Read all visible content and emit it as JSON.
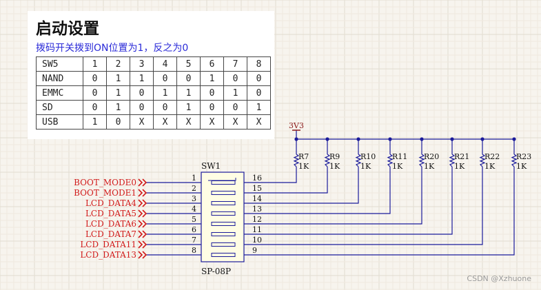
{
  "title": "启动设置",
  "subtitle": "拨码开关拨到ON位置为1，反之为0",
  "table": {
    "header": [
      "SW5",
      "1",
      "2",
      "3",
      "4",
      "5",
      "6",
      "7",
      "8"
    ],
    "rows": [
      [
        "NAND",
        "0",
        "1",
        "1",
        "0",
        "0",
        "1",
        "0",
        "0"
      ],
      [
        "EMMC",
        "0",
        "1",
        "0",
        "1",
        "1",
        "0",
        "1",
        "0"
      ],
      [
        "SD",
        "0",
        "1",
        "0",
        "0",
        "1",
        "0",
        "0",
        "1"
      ],
      [
        "USB",
        "1",
        "0",
        "X",
        "X",
        "X",
        "X",
        "X",
        "X"
      ]
    ]
  },
  "schematic": {
    "power_label": "3V3",
    "switch_ref": "SW1",
    "switch_part": "SP-08P",
    "nets": [
      "BOOT_MODE0",
      "BOOT_MODE1",
      "LCD_DATA4",
      "LCD_DATA5",
      "LCD_DATA6",
      "LCD_DATA7",
      "LCD_DATA11",
      "LCD_DATA13"
    ],
    "left_pins": [
      "1",
      "2",
      "3",
      "4",
      "5",
      "6",
      "7",
      "8"
    ],
    "right_pins": [
      "16",
      "15",
      "14",
      "13",
      "12",
      "11",
      "10",
      "9"
    ],
    "resistors": [
      {
        "ref": "R7",
        "value": "1K"
      },
      {
        "ref": "R9",
        "value": "1K"
      },
      {
        "ref": "R10",
        "value": "1K"
      },
      {
        "ref": "R11",
        "value": "1K"
      },
      {
        "ref": "R20",
        "value": "1K"
      },
      {
        "ref": "R21",
        "value": "1K"
      },
      {
        "ref": "R22",
        "value": "1K"
      },
      {
        "ref": "R23",
        "value": "1K"
      }
    ]
  },
  "watermark": "CSDN @Xzhuone",
  "colors": {
    "wire": "#1a1a9a",
    "net_label": "#d11a1a",
    "power": "#8b1a1a",
    "subtitle": "#2a2ad8"
  }
}
